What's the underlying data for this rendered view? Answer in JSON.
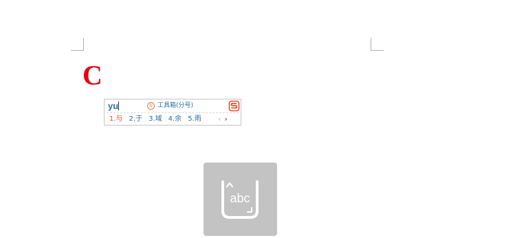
{
  "document": {
    "typed_char": "C"
  },
  "ime": {
    "input_text": "yu",
    "toolbox": {
      "number": "①",
      "label": "工具箱(分号)"
    },
    "logo_icon": "sogou-logo-icon",
    "candidates": [
      {
        "text": "1.与",
        "selected": true
      },
      {
        "text": "2.于",
        "selected": false
      },
      {
        "text": "3.域",
        "selected": false
      },
      {
        "text": "4.余",
        "selected": false
      },
      {
        "text": "5.雨",
        "selected": false
      }
    ],
    "pager": {
      "prev": "‹",
      "next": "›"
    },
    "colors": {
      "text_blue": "#2d6ca2",
      "accent_orange": "#e0502a"
    }
  },
  "keyboard_toggle": {
    "label": "abc",
    "icon": "keyboard-abc-icon",
    "background": "#c3c3c3"
  }
}
